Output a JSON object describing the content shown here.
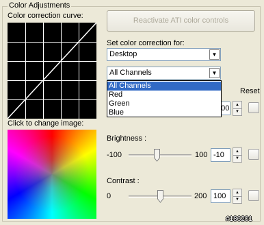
{
  "group": {
    "title": "Color Adjustments"
  },
  "curve": {
    "label": "Color correction curve:"
  },
  "image": {
    "label": "Click to change image:"
  },
  "reactivate_button": {
    "label": "Reactivate ATI color controls",
    "disabled": true
  },
  "target": {
    "label": "Set color correction for:",
    "selected": "Desktop"
  },
  "channel": {
    "selected": "All Channels",
    "options": [
      "All Channels",
      "Red",
      "Green",
      "Blue"
    ],
    "highlighted_index": 0
  },
  "reset_label": "Reset",
  "gamma": {
    "value": "1.00",
    "level": 0.5
  },
  "brightness": {
    "label": "Brightness :",
    "min": "-100",
    "max": "100",
    "value": "-10",
    "level": 0.45
  },
  "contrast": {
    "label": "Contrast :",
    "min": "0",
    "max": "200",
    "value": "100",
    "level": 0.5
  },
  "footer_id": "#186201",
  "colors": {
    "selection": "#316ac5",
    "background": "#ece9d8",
    "field_border": "#7f9db9"
  }
}
